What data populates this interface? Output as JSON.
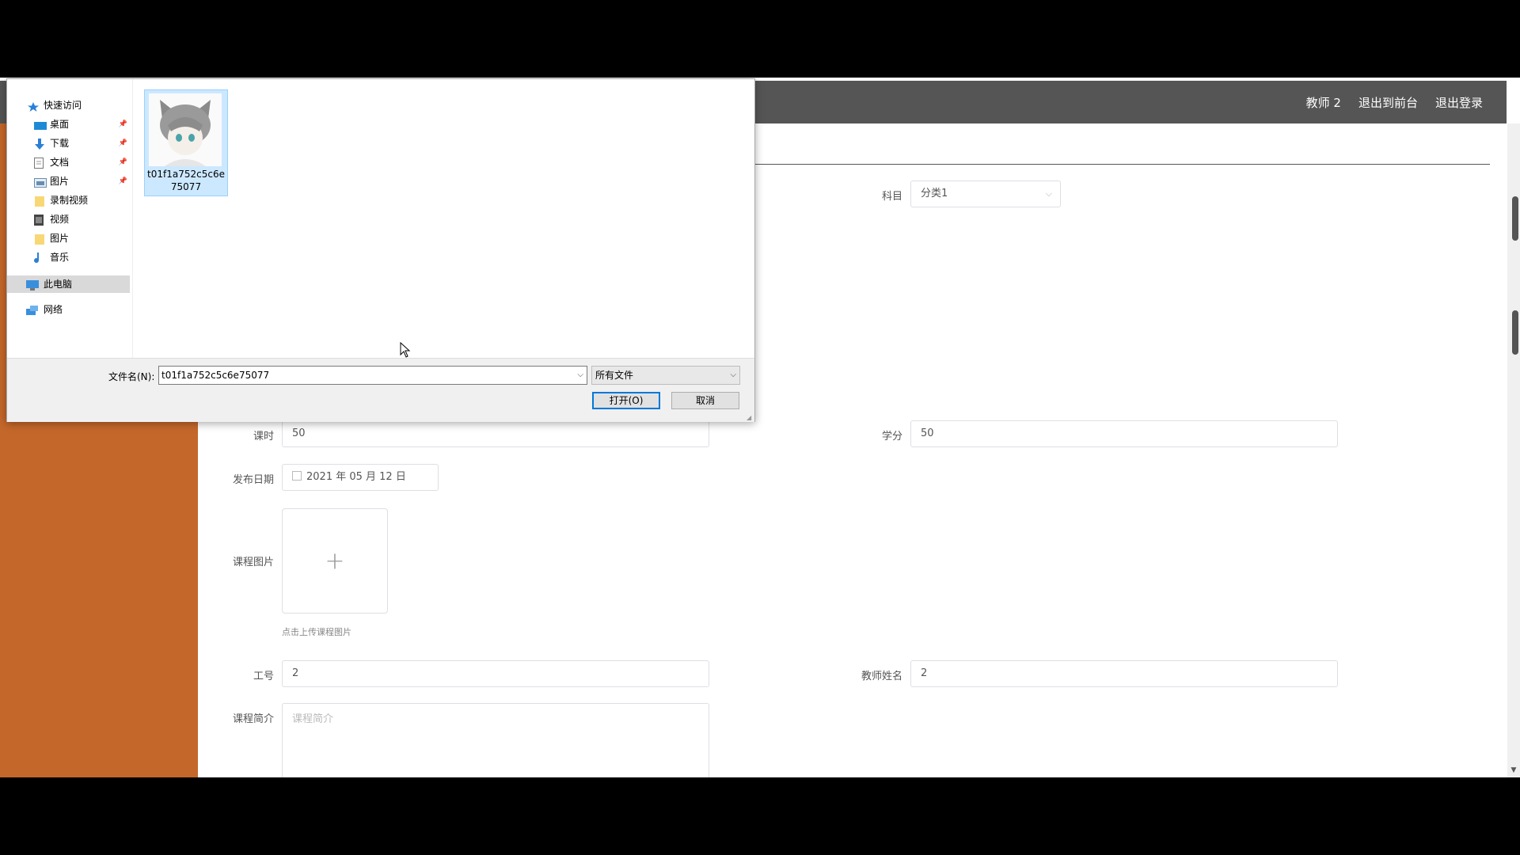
{
  "header": {
    "user": "教师 2",
    "back_to_front": "退出到前台",
    "logout": "退出登录"
  },
  "form": {
    "subject": {
      "label": "科目",
      "value": "分类1"
    },
    "hours": {
      "label": "课时",
      "value": "50"
    },
    "credits": {
      "label": "学分",
      "value": "50"
    },
    "publish_date": {
      "label": "发布日期",
      "value": "2021 年 05 月 12 日"
    },
    "course_image": {
      "label": "课程图片",
      "hint": "点击上传课程图片"
    },
    "employee_id": {
      "label": "工号",
      "value": "2"
    },
    "teacher_name": {
      "label": "教师姓名",
      "value": "2"
    },
    "course_intro": {
      "label": "课程简介",
      "placeholder": "课程简介"
    }
  },
  "file_dialog": {
    "nav": [
      {
        "label": "快速访问",
        "icon": "star-icon"
      },
      {
        "label": "桌面",
        "icon": "desktop-icon",
        "pinned": true
      },
      {
        "label": "下载",
        "icon": "download-icon",
        "pinned": true
      },
      {
        "label": "文档",
        "icon": "document-icon",
        "pinned": true
      },
      {
        "label": "图片",
        "icon": "pictures-icon",
        "pinned": true
      },
      {
        "label": "录制视频",
        "icon": "folder-icon"
      },
      {
        "label": "视频",
        "icon": "video-icon"
      },
      {
        "label": "图片",
        "icon": "folder-icon"
      },
      {
        "label": "音乐",
        "icon": "music-icon"
      },
      {
        "label": "此电脑",
        "icon": "computer-icon",
        "selected": true
      },
      {
        "label": "网络",
        "icon": "network-icon"
      }
    ],
    "file": {
      "name": "t01f1a752c5c6e75077"
    },
    "filename_label": "文件名(N):",
    "filename_value": "t01f1a752c5c6e75077",
    "filetype": "所有文件",
    "open_button": "打开(O)",
    "cancel_button": "取消"
  }
}
